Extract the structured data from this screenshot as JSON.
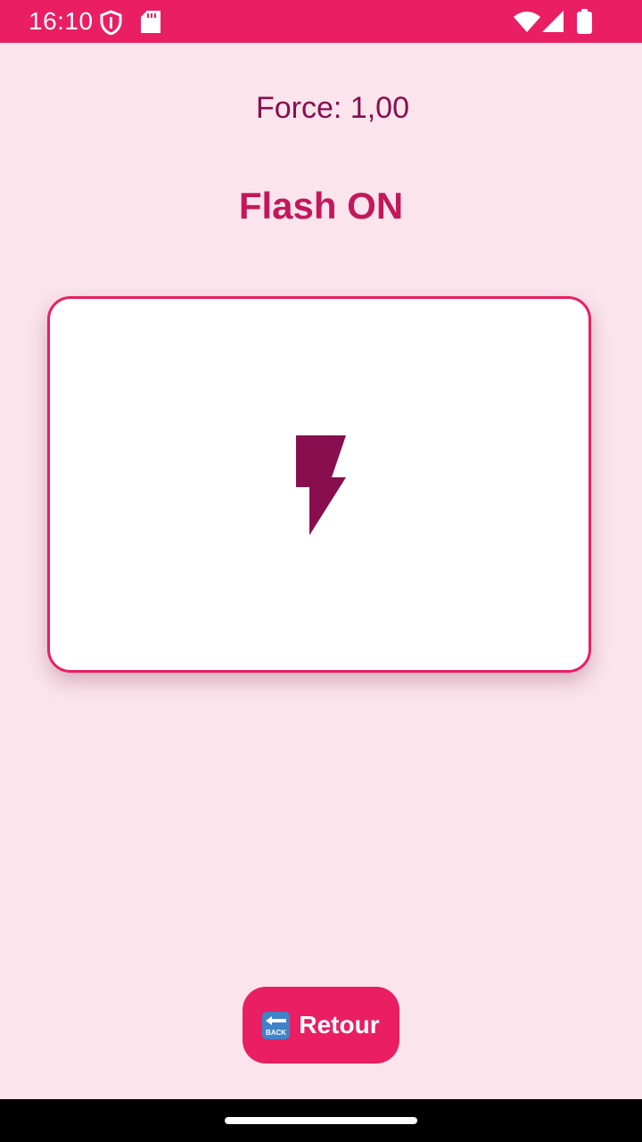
{
  "status_bar": {
    "time": "16:10",
    "background_color": "#e91e63",
    "icons": [
      "shield-icon",
      "sd-card-icon",
      "wifi-icon",
      "cellular-signal-icon",
      "battery-icon"
    ]
  },
  "main": {
    "force_text": "Force: 1,00",
    "flash_status": "Flash ON",
    "card_icon": "lightning-bolt-icon",
    "accent_color": "#e91e63",
    "text_color": "#880e4f",
    "background_color": "#fbe4ec"
  },
  "back_button": {
    "icon": "back-arrow-emoji-icon",
    "label": "Retour"
  },
  "nav_bar": {
    "handle": "home-gesture-handle"
  }
}
